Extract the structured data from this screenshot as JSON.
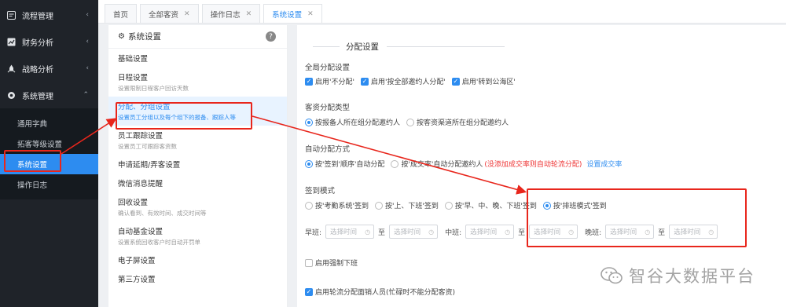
{
  "sidebar": {
    "items": [
      {
        "icon": "process-icon",
        "label": "流程管理",
        "arrow": "‹"
      },
      {
        "icon": "finance-chart-icon",
        "label": "财务分析",
        "arrow": "‹"
      },
      {
        "icon": "rocket-icon",
        "label": "战略分析",
        "arrow": "‹"
      },
      {
        "icon": "gear-icon",
        "label": "系统管理",
        "arrow": "⌃"
      }
    ],
    "subitems": [
      "通用字典",
      "拓客等级设置",
      "系统设置",
      "操作日志"
    ],
    "active_subitem": "系统设置"
  },
  "tabs": [
    {
      "label": "首页",
      "closable": false
    },
    {
      "label": "全部客资",
      "closable": true
    },
    {
      "label": "操作日志",
      "closable": true
    },
    {
      "label": "系统设置",
      "closable": true,
      "active": true
    }
  ],
  "menu": {
    "title": "系统设置",
    "help": "?",
    "items": [
      {
        "title": "基础设置",
        "desc": ""
      },
      {
        "title": "日程设置",
        "desc": "设置限制日程客户回访天数"
      },
      {
        "title": "分配、分组设置",
        "desc": "设置员工分组以及每个组下的报备、跟踪人等",
        "active": true
      },
      {
        "title": "员工跟踪设置",
        "desc": "设置员工可跟踪客资数"
      },
      {
        "title": "申请延期/弄客设置",
        "desc": ""
      },
      {
        "title": "微信消息提醒",
        "desc": ""
      },
      {
        "title": "回收设置",
        "desc": "确认看到、有效时间、成交时间等"
      },
      {
        "title": "自动基金设置",
        "desc": "设置系统回收客户时自动开罚单"
      },
      {
        "title": "电子屏设置",
        "desc": ""
      },
      {
        "title": "第三方设置",
        "desc": ""
      }
    ]
  },
  "content": {
    "section_title": "分配设置",
    "global_label": "全局分配设置",
    "global_options": [
      {
        "label": "启用'不分配'",
        "checked": true
      },
      {
        "label": "启用'按全部邀约人分配'",
        "checked": true
      },
      {
        "label": "启用'转到公海区'",
        "checked": true
      }
    ],
    "lead_type_label": "客资分配类型",
    "lead_type_options": [
      {
        "label": "按报备人所在组分配邀约人",
        "selected": true
      },
      {
        "label": "按客资渠道所在组分配邀约人",
        "selected": false
      }
    ],
    "auto_label": "自动分配方式",
    "auto_options": [
      {
        "label": "按'签到'顺序'自动分配",
        "selected": true
      },
      {
        "label": "按'成交率'自动分配邀约人",
        "selected": false
      }
    ],
    "auto_warning": "(没添加成交率则自动轮流分配)",
    "auto_link": "设置成交率",
    "sign_label": "签到模式",
    "sign_options": [
      {
        "label": "按'考勤系统'签到",
        "selected": false
      },
      {
        "label": "按'上、下班'签到",
        "selected": false
      },
      {
        "label": "按'早、中、晚、下班'签到",
        "selected": false
      },
      {
        "label": "按'排班模式'签到",
        "selected": true
      }
    ],
    "shifts": [
      {
        "label": "早班:",
        "from": "选择时间",
        "to": "选择时间"
      },
      {
        "label": "中班:",
        "from": "选择时间",
        "to": "选择时间"
      },
      {
        "label": "晚班:",
        "from": "选择时间",
        "to": "选择时间"
      }
    ],
    "to_text": "至",
    "force_off": {
      "label": "启用强制下班",
      "checked": false
    },
    "rotate": {
      "label": "启用轮流分配面销人员(忙碌时不能分配客资)",
      "checked": true
    }
  },
  "watermark": {
    "text": "智谷大数据平台",
    "icon": "wechat-icon"
  },
  "colors": {
    "accent": "#2d8cf0",
    "annotation": "#e8261c",
    "sidebar": "#1f2329"
  }
}
